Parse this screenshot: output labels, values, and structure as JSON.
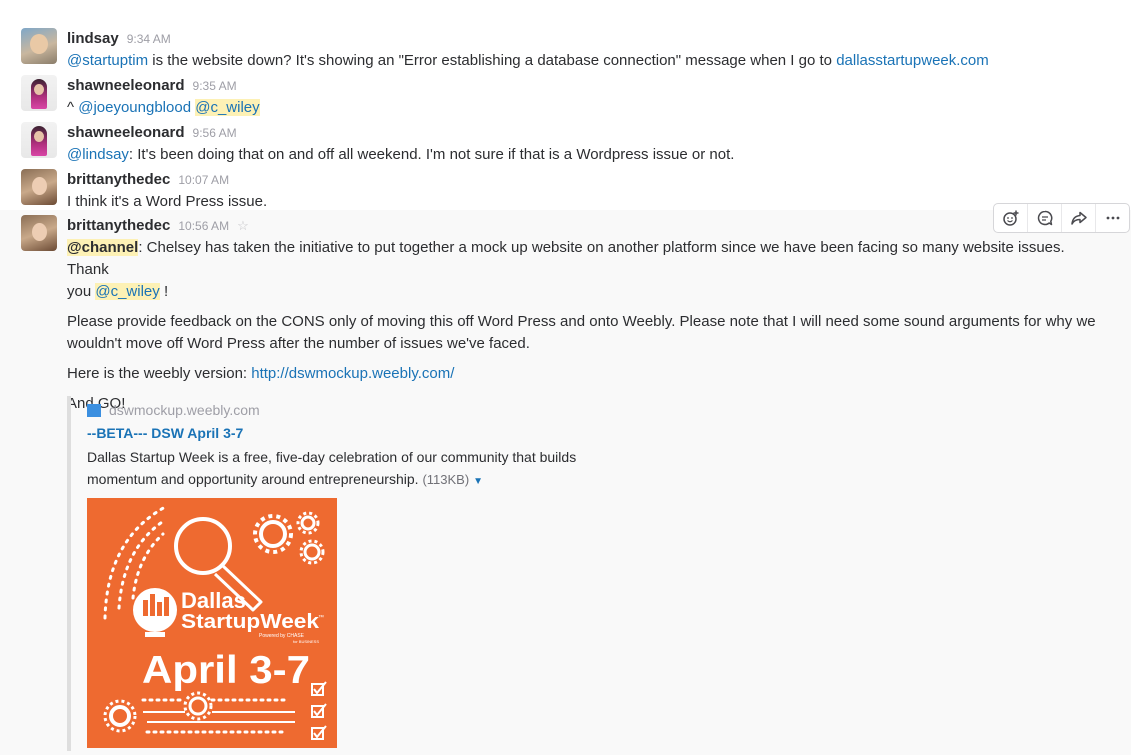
{
  "messages": [
    {
      "user": "lindsay",
      "time": "9:34 AM",
      "mention": "@startuptim",
      "text": " is the website down? It's showing an \"Error establishing a database connection\" message when I go to ",
      "link": "dallasstartupweek.com"
    },
    {
      "user": "shawneeleonard",
      "time": "9:35 AM",
      "prefix": "^ ",
      "mention1": "@joeyoungblood",
      "mention2": "@c_wiley"
    },
    {
      "user": "shawneeleonard",
      "time": "9:56 AM",
      "mention": "@lindsay",
      "text": ": It's been doing that on and off all weekend. I'm not sure if that is a Wordpress issue or not."
    },
    {
      "user": "brittanythedec",
      "time": "10:07 AM",
      "text": "I think it's a Word Press issue."
    },
    {
      "user": "brittanythedec",
      "time": "10:56 AM",
      "channel": "@channel",
      "p1a": ": Chelsey has taken the initiative to put together a mock up website on another platform since we have been facing so many website issues. Thank",
      "p1b_prefix": "you ",
      "p1b_mention": "@c_wiley",
      "p1b_suffix": " !",
      "p2a": "Please provide feedback on the CONS only of moving this off Word Press and onto Weebly. Please note that I will need some sound arguments for why we",
      "p2b": "wouldn't move off Word Press after the number of issues we've faced.",
      "p3_text": "Here is the weebly version: ",
      "p3_link": "http://dswmockup.weebly.com/",
      "p4": "And GO!"
    }
  ],
  "attachment": {
    "site": "dswmockup.weebly.com",
    "title": "--BETA--- DSW April 3-7",
    "desc_line1": "Dallas Startup Week is a free, five-day celebration of our community that builds",
    "desc_line2": "momentum and opportunity around entrepreneurship. ",
    "size": "(113KB)",
    "image": {
      "bg": "#ee6a30",
      "line1": "Dallas",
      "line2": "StartupWeek",
      "powered": "Powered by CHASE",
      "for_business": "for BUSINESS",
      "tm": "™",
      "dates": "April 3-7"
    }
  },
  "actions": [
    {
      "name": "add-reaction-icon"
    },
    {
      "name": "start-thread-icon"
    },
    {
      "name": "share-message-icon"
    },
    {
      "name": "more-actions-icon"
    }
  ],
  "colors": {
    "link": "#1a73b6",
    "highlight": "#fdf1b5",
    "image_orange": "#ee6a30"
  }
}
